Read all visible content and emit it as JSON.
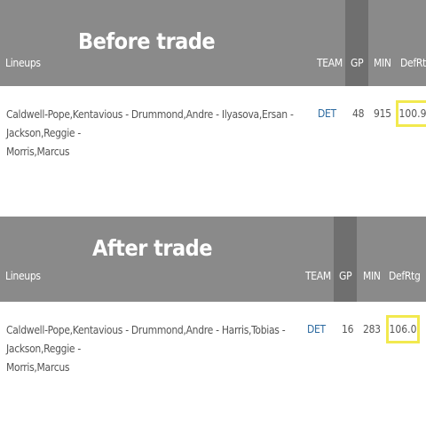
{
  "before": {
    "title": "Before trade",
    "columns": {
      "lineups": "Lineups",
      "team": "TEAM",
      "gp": "GP",
      "min": "MIN",
      "defrtg": "DefRtg"
    },
    "row": {
      "lineup_line1": "Caldwell-Pope,Kentavious - Drummond,Andre - Ilyasova,Ersan - Jackson,Reggie -",
      "lineup_line2": "Morris,Marcus",
      "team": "DET",
      "gp": "48",
      "min": "915",
      "defrtg": "100.9"
    }
  },
  "after": {
    "title": "After trade",
    "columns": {
      "lineups": "Lineups",
      "team": "TEAM",
      "gp": "GP",
      "min": "MIN",
      "defrtg": "DefRtg"
    },
    "row": {
      "lineup_line1": "Caldwell-Pope,Kentavious - Drummond,Andre - Harris,Tobias - Jackson,Reggie -",
      "lineup_line2": "Morris,Marcus",
      "team": "DET",
      "gp": "16",
      "min": "283",
      "defrtg": "106.0"
    }
  },
  "colors": {
    "header_bg": "#8a8a8a",
    "gp_column_bg": "#6f6f6f",
    "team_link": "#2c6aa0",
    "highlight_box": "#f2e94e"
  }
}
